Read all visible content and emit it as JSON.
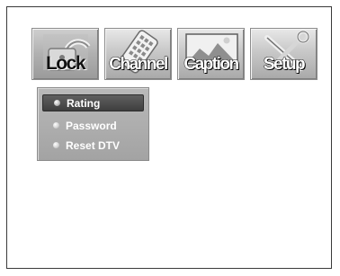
{
  "tabs": [
    {
      "label": "Lock",
      "icon": "lock-icon",
      "active": true
    },
    {
      "label": "Channel",
      "icon": "remote-control-icon",
      "active": false
    },
    {
      "label": "Caption",
      "icon": "picture-caption-icon",
      "active": false
    },
    {
      "label": "Setup",
      "icon": "tools-icon",
      "active": false
    }
  ],
  "submenu": {
    "items": [
      {
        "label": "Rating",
        "selected": true
      },
      {
        "label": "Password",
        "selected": false
      },
      {
        "label": "Reset DTV",
        "selected": false
      }
    ]
  }
}
